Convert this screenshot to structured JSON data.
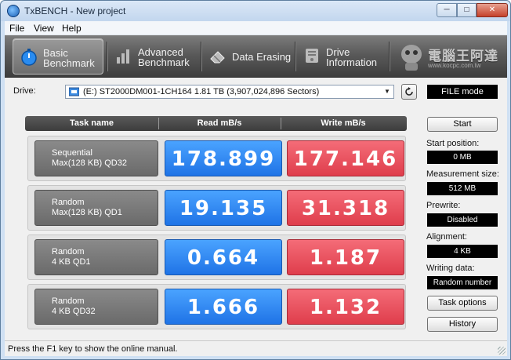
{
  "window": {
    "title": "TxBENCH - New project",
    "min": "─",
    "max": "□",
    "close": "✕"
  },
  "menu": [
    {
      "label": "File"
    },
    {
      "label": "View"
    },
    {
      "label": "Help"
    }
  ],
  "toolbar": {
    "items": [
      {
        "label": "Basic\nBenchmark",
        "icon": "stopwatch-icon",
        "active": true
      },
      {
        "label": "Advanced\nBenchmark",
        "icon": "bar-chart-icon",
        "active": false
      },
      {
        "label": "Data Erasing",
        "icon": "eraser-icon",
        "active": false
      },
      {
        "label": "Drive\nInformation",
        "icon": "drive-info-icon",
        "active": false
      }
    ],
    "logo_text": "電腦王阿達",
    "logo_sub": "www.kocpc.com.tw"
  },
  "drive": {
    "label": "Drive:",
    "selected": "(E:) ST2000DM001-1CH164  1.81 TB (3,907,024,896 Sectors)",
    "mode": "FILE mode"
  },
  "table": {
    "headers": [
      "Task name",
      "Read mB/s",
      "Write mB/s"
    ],
    "rows": [
      {
        "task1": "Sequential",
        "task2": "Max(128 KB) QD32",
        "read": "178.899",
        "write": "177.146"
      },
      {
        "task1": "Random",
        "task2": "Max(128 KB) QD1",
        "read": "19.135",
        "write": "31.318"
      },
      {
        "task1": "Random",
        "task2": "4 KB QD1",
        "read": "0.664",
        "write": "1.187"
      },
      {
        "task1": "Random",
        "task2": "4 KB QD32",
        "read": "1.666",
        "write": "1.132"
      }
    ]
  },
  "side": {
    "start": "Start",
    "start_position_label": "Start position:",
    "start_position": "0 MB",
    "measurement_size_label": "Measurement size:",
    "measurement_size": "512 MB",
    "prewrite_label": "Prewrite:",
    "prewrite": "Disabled",
    "alignment_label": "Alignment:",
    "alignment": "4 KB",
    "writing_data_label": "Writing data:",
    "writing_data": "Random number",
    "task_options": "Task options",
    "history": "History"
  },
  "colors": {
    "read": "#2f86f2",
    "write": "#e84d5b",
    "toolbar": "#555555"
  },
  "status": "Press the F1 key to show the online manual."
}
